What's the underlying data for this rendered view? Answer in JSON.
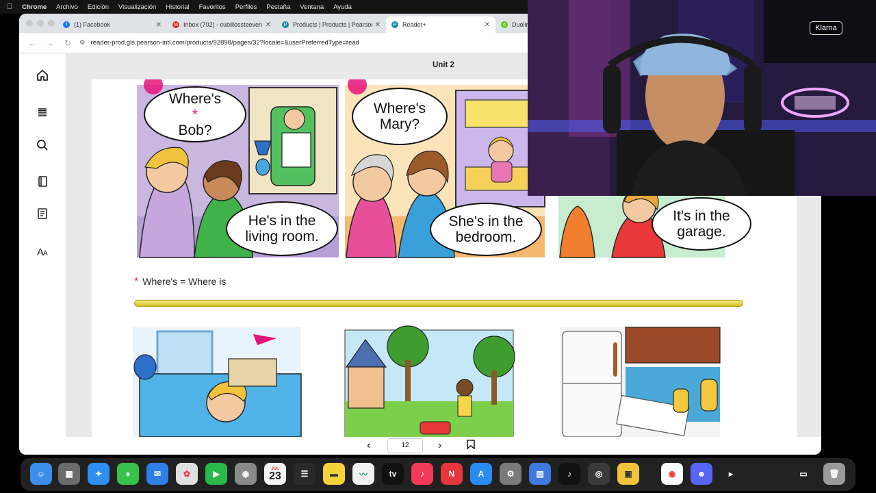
{
  "menubar": {
    "app": "Chrome",
    "items": [
      "Archivo",
      "Edición",
      "Visualización",
      "Historial",
      "Favoritos",
      "Perfiles",
      "Pestaña",
      "Ventana",
      "Ayuda"
    ]
  },
  "tabs": [
    {
      "label": "(1) Facebook",
      "icon": "facebook-icon",
      "color": "#1877f2"
    },
    {
      "label": "Inbox (702) - cubillossteeven",
      "icon": "gmail-icon",
      "color": "#d93025"
    },
    {
      "label": "Products | Products | Pearson",
      "icon": "pearson-icon",
      "color": "#1a8fa6"
    },
    {
      "label": "Reader+",
      "icon": "pearson-icon",
      "color": "#1a8fa6"
    },
    {
      "label": "Duoling",
      "icon": "duolingo-icon",
      "color": "#58cc02"
    }
  ],
  "address": {
    "url": "reader-prod.gls.pearson-intl.com/products/92898/pages/32?locale=&userPreferredType=read"
  },
  "reader": {
    "unit_title": "Unit 2",
    "speech": {
      "q1_line1": "Where's",
      "q1_star": "*",
      "q1_line2": "Bob?",
      "q2_line1": "Where's",
      "q2_line2": "Mary?",
      "a1_line1": "He's in the",
      "a1_line2": "living room.",
      "a2_line1": "She's in the",
      "a2_line2": "bedroom.",
      "a3_line1": "It's in the",
      "a3_line2": "garage."
    },
    "footnote": {
      "star": "*",
      "text": "Where's = Where is"
    },
    "page_number": "12"
  },
  "webcam": {
    "sign": "Klarna"
  },
  "dock": {
    "calendar_day": "23",
    "calendar_month": "JUL"
  },
  "colors": {
    "accent_pink": "#e6137a",
    "divider_gold": "#d9c22a"
  }
}
